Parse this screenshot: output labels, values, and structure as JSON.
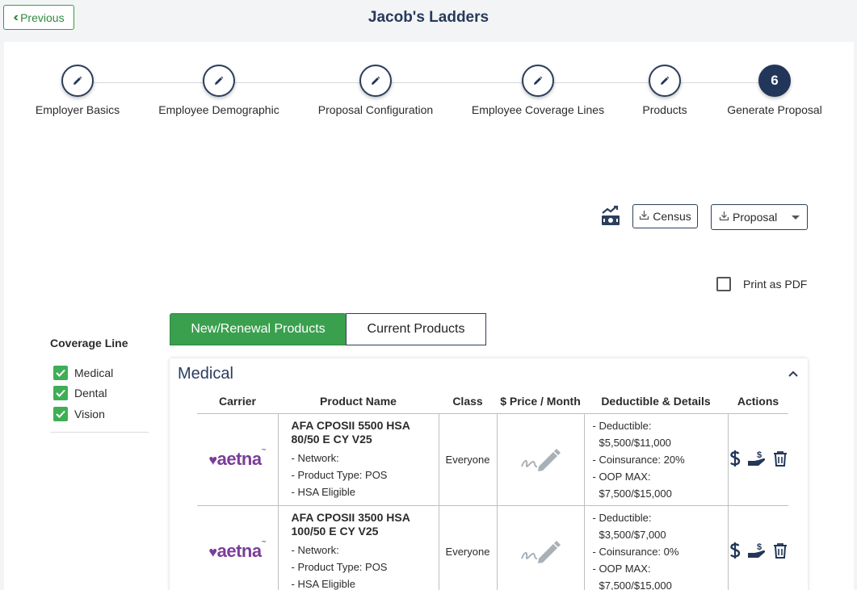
{
  "header": {
    "previous_label": "Previous",
    "title": "Jacob's Ladders"
  },
  "stepper": {
    "steps": [
      {
        "label": "Employer Basics",
        "state": "done"
      },
      {
        "label": "Employee Demographic",
        "state": "done"
      },
      {
        "label": "Proposal Configuration",
        "state": "done"
      },
      {
        "label": "Employee Coverage Lines",
        "state": "done"
      },
      {
        "label": "Products",
        "state": "done"
      },
      {
        "label": "Generate Proposal",
        "state": "active",
        "number": "6"
      }
    ]
  },
  "toolbar": {
    "chart_icon": "chart-money-icon",
    "census_label": "Census",
    "proposal_label": "Proposal"
  },
  "print_pdf": {
    "label": "Print as PDF",
    "checked": false
  },
  "coverage_lines": {
    "title": "Coverage Line",
    "items": [
      {
        "label": "Medical",
        "checked": true
      },
      {
        "label": "Dental",
        "checked": true
      },
      {
        "label": "Vision",
        "checked": true
      }
    ]
  },
  "tabs": {
    "active": "New/Renewal Products",
    "inactive": "Current Products"
  },
  "section": {
    "title": "Medical",
    "columns": [
      "Carrier",
      "Product Name",
      "Class",
      "$ Price / Month",
      "Deductible & Details",
      "Actions"
    ],
    "rows": [
      {
        "carrier": "aetna",
        "product_name": "AFA CPOSII 5500 HSA 80/50 E CY V25",
        "network": "- Network:",
        "product_type": "- Product Type: POS",
        "hsa": "- HSA Eligible",
        "class": "Everyone",
        "deductible_label": "- Deductible:",
        "deductible_value": "$5,500/$11,000",
        "coinsurance": "- Coinsurance: 20%",
        "oop_label": "- OOP MAX:",
        "oop_value": "$7,500/$15,000"
      },
      {
        "carrier": "aetna",
        "product_name": "AFA CPOSII 3500 HSA 100/50 E CY V25",
        "network": "- Network:",
        "product_type": "- Product Type: POS",
        "hsa": "- HSA Eligible",
        "class": "Everyone",
        "deductible_label": "- Deductible:",
        "deductible_value": "$3,500/$7,000",
        "coinsurance": "- Coinsurance: 0%",
        "oop_label": "- OOP MAX:",
        "oop_value": "$7,500/$15,000"
      }
    ]
  },
  "colors": {
    "green": "#3aa04e",
    "navy": "#22365a",
    "aetna_purple": "#7a3d9a"
  }
}
